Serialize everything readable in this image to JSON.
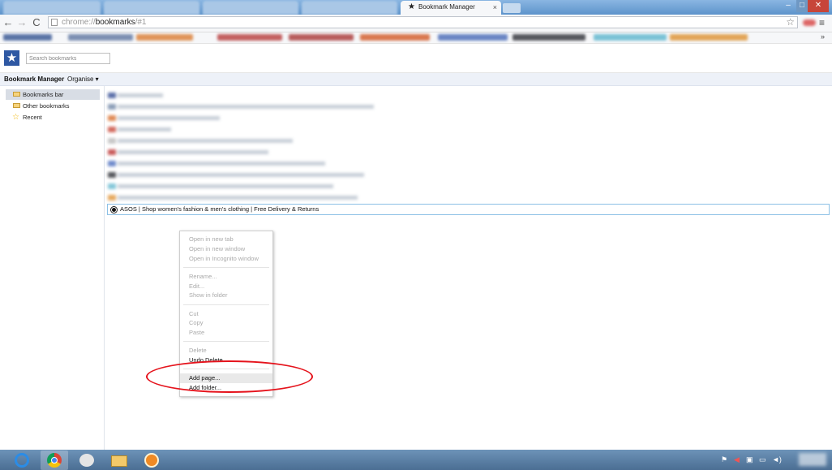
{
  "browser": {
    "active_tab_title": "Bookmark Manager",
    "tab_close": "×",
    "url_scheme": "chrome://",
    "url_host": "bookmarks",
    "url_path": "/#1",
    "window_controls": [
      "–",
      "□",
      "✕"
    ],
    "bookmarks_more": "»"
  },
  "manager": {
    "search_placeholder": "Search bookmarks",
    "title": "Bookmark Manager",
    "organise_label": "Organise ▾"
  },
  "tree": {
    "items": [
      {
        "label": "Bookmarks bar",
        "selected": true
      },
      {
        "label": "Other bookmarks",
        "selected": false
      },
      {
        "label": "Recent",
        "selected": false
      }
    ]
  },
  "list": {
    "selected_item": "ASOS | Shop women's fashion & men's clothing | Free Delivery & Returns"
  },
  "context_menu": {
    "items": [
      {
        "label": "Open in new tab",
        "enabled": false
      },
      {
        "label": "Open in new window",
        "enabled": false
      },
      {
        "label": "Open in Incognito window",
        "enabled": false
      },
      {
        "label": "Rename...",
        "enabled": false
      },
      {
        "label": "Edit...",
        "enabled": false
      },
      {
        "label": "Show in folder",
        "enabled": false
      },
      {
        "label": "Cut",
        "enabled": false
      },
      {
        "label": "Copy",
        "enabled": false
      },
      {
        "label": "Paste",
        "enabled": false
      },
      {
        "label": "Delete",
        "enabled": false
      },
      {
        "label": "Undo Delete",
        "enabled": true
      },
      {
        "label": "Add page...",
        "enabled": true
      },
      {
        "label": "Add folder...",
        "enabled": true
      }
    ]
  },
  "colors": {
    "annotation_circle": "#e5131c",
    "selection_border": "#8cc0e6",
    "logo_blue": "#2e58a3"
  }
}
